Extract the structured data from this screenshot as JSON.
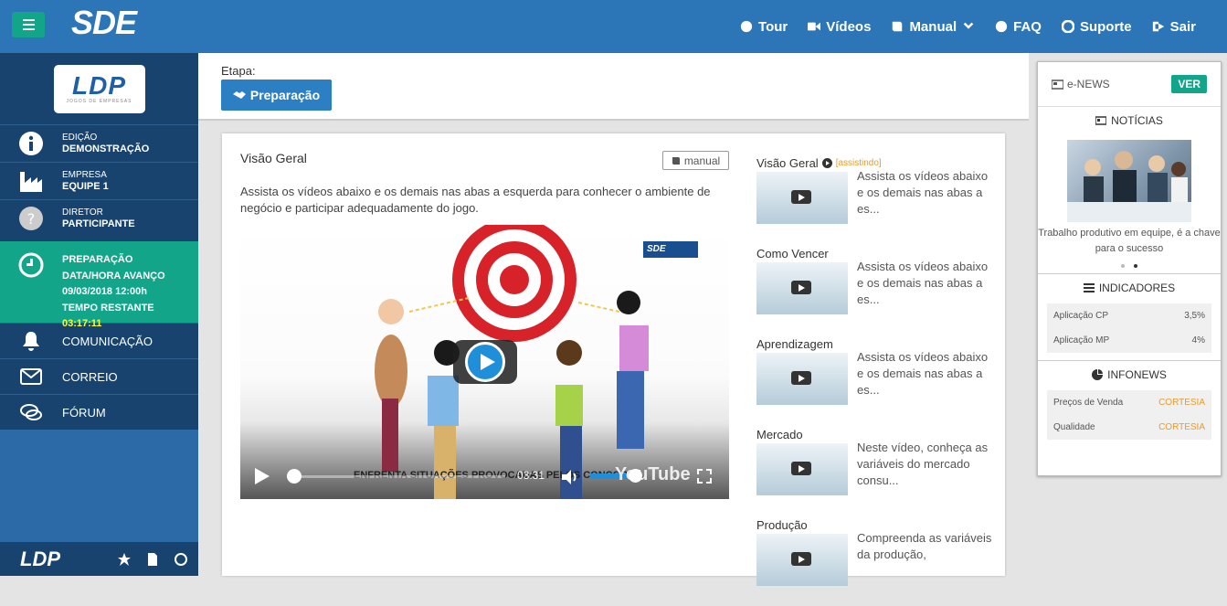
{
  "topbar": {
    "brand": "SDE",
    "nav": [
      {
        "label": "Tour",
        "icon": "globe-icon"
      },
      {
        "label": "Vídeos",
        "icon": "video-camera-icon"
      },
      {
        "label": "Manual",
        "icon": "book-icon"
      },
      {
        "label": "FAQ",
        "icon": "question-circle-icon"
      },
      {
        "label": "Suporte",
        "icon": "lifebuoy-icon"
      },
      {
        "label": "Sair",
        "icon": "sign-out-icon"
      }
    ]
  },
  "sidebar": {
    "logo_text": "LDP",
    "logo_sub": "JOGOS DE EMPRESAS",
    "edition": {
      "label": "EDIÇÃO",
      "value": "DEMONSTRAÇÃO"
    },
    "company": {
      "label": "EMPRESA",
      "value": "EQUIPE 1"
    },
    "director": {
      "label": "DIRETOR",
      "value": "PARTICIPANTE"
    },
    "stage": {
      "name": "PREPARAÇÃO",
      "advance_label": "DATA/HORA AVANÇO",
      "advance_value": "09/03/2018 12:00h",
      "remaining_label": "TEMPO RESTANTE",
      "remaining_value": "03:17:11"
    },
    "links": [
      {
        "label": "COMUNICAÇÃO"
      },
      {
        "label": "CORREIO"
      },
      {
        "label": "FÓRUM"
      }
    ],
    "footer_logo": "LDP"
  },
  "stagebar": {
    "label": "Etapa:",
    "button": "Preparação"
  },
  "main": {
    "title": "Visão Geral",
    "manual_btn": "manual",
    "description": "Assista os vídeos abaixo e os demais nas abas a esquerda para conhecer o ambiente de negócio e participar adequadamente do jogo.",
    "video": {
      "watermark": "SDE",
      "subtitle": "ENFRENTA SITUAÇÕES PROVOCADAS PELOS CONCORR...",
      "time": "03:31",
      "youtube": "YouTube",
      "progress": 0.0,
      "volume": 0.85
    }
  },
  "videos": [
    {
      "title": "Visão Geral",
      "watching": "[assistindo]",
      "desc": "Assista os vídeos abaixo e os demais nas abas a es..."
    },
    {
      "title": "Como Vencer",
      "desc": "Assista os vídeos abaixo e os demais nas abas a es..."
    },
    {
      "title": "Aprendizagem",
      "desc": "Assista os vídeos abaixo e os demais nas abas a es..."
    },
    {
      "title": "Mercado",
      "desc": "Neste vídeo, conheça as variáveis do mercado consu..."
    },
    {
      "title": "Produção",
      "desc": "Compreenda as variáveis da produção,"
    }
  ],
  "enews": {
    "title": "e-NEWS",
    "ver": "VER",
    "noticias": "NOTÍCIAS",
    "caption": "Trabalho produtivo em equipe, é a chave para o sucesso",
    "indicadores": "INDICADORES",
    "indicators": [
      {
        "name": "Aplicação CP",
        "value": "3,5%"
      },
      {
        "name": "Aplicação MP",
        "value": "4%"
      }
    ],
    "infonews": "INFONEWS",
    "info": [
      {
        "name": "Preços de Venda",
        "value": "CORTESIA"
      },
      {
        "name": "Qualidade",
        "value": "CORTESIA"
      }
    ]
  },
  "colors": {
    "primary": "#2c76b7",
    "accent": "#13a58a",
    "sidebar_dark": "#17436e",
    "highlight": "#e89c2e"
  }
}
